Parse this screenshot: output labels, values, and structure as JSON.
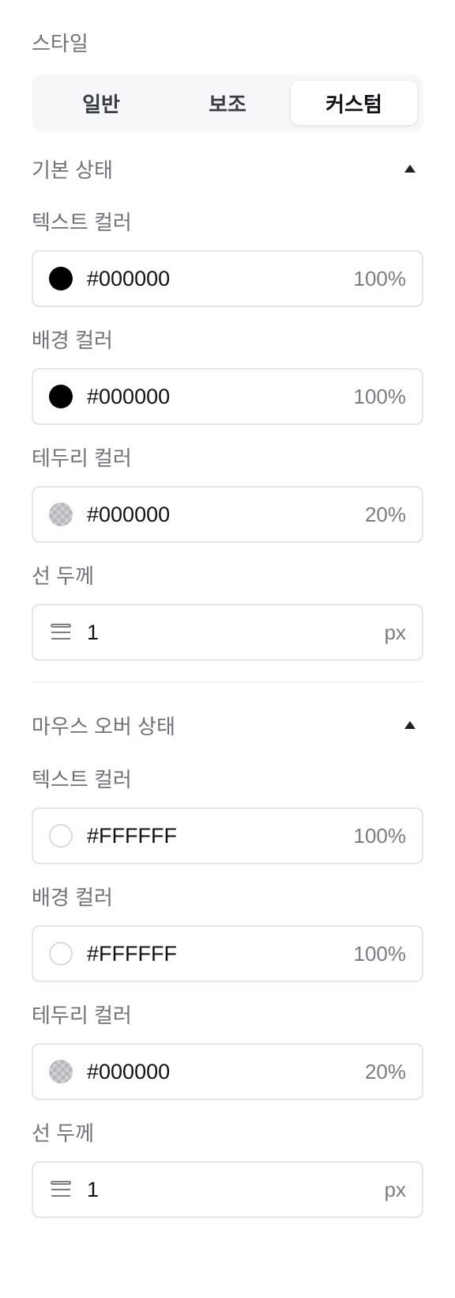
{
  "style": {
    "label": "스타일",
    "tabs": [
      {
        "label": "일반",
        "active": false
      },
      {
        "label": "보조",
        "active": false
      },
      {
        "label": "커스텀",
        "active": true
      }
    ]
  },
  "default_state": {
    "title": "기본 상태",
    "text_color": {
      "label": "텍스트 컬러",
      "hex": "#000000",
      "opacity": "100%",
      "swatch": "black"
    },
    "bg_color": {
      "label": "배경 컬러",
      "hex": "#000000",
      "opacity": "100%",
      "swatch": "black"
    },
    "border_color": {
      "label": "테두리 컬러",
      "hex": "#000000",
      "opacity": "20%",
      "swatch": "transparent-checker"
    },
    "line_width": {
      "label": "선 두께",
      "value": "1",
      "unit": "px"
    }
  },
  "hover_state": {
    "title": "마우스 오버 상태",
    "text_color": {
      "label": "텍스트 컬러",
      "hex": "#FFFFFF",
      "opacity": "100%",
      "swatch": "white"
    },
    "bg_color": {
      "label": "배경 컬러",
      "hex": "#FFFFFF",
      "opacity": "100%",
      "swatch": "white"
    },
    "border_color": {
      "label": "테두리 컬러",
      "hex": "#000000",
      "opacity": "20%",
      "swatch": "transparent-checker"
    },
    "line_width": {
      "label": "선 두께",
      "value": "1",
      "unit": "px"
    }
  },
  "icons": {
    "collapse": "caret-up-icon",
    "line_width": "line-weight-icon"
  }
}
